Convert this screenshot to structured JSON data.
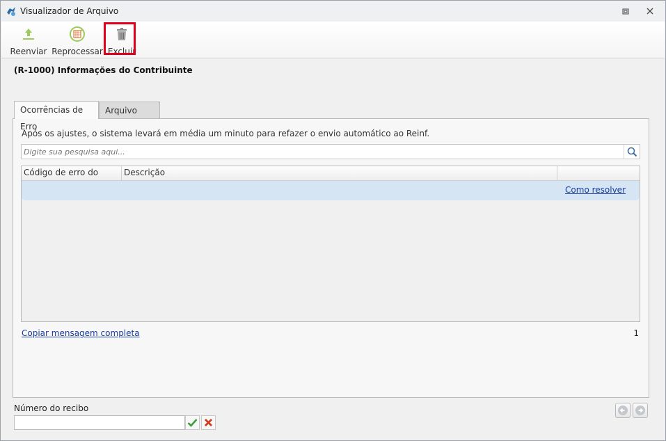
{
  "window": {
    "title": "Visualizador de Arquivo"
  },
  "toolbar": {
    "resend_label": "Reenviar",
    "reprocess_label": "Reprocessar",
    "delete_label": "Excluir"
  },
  "heading": "(R-1000) Informações do Contribuinte",
  "tabs": [
    {
      "label": "Ocorrências de Erro",
      "active": true
    },
    {
      "label": "Arquivo XML",
      "active": false
    }
  ],
  "panel": {
    "info_text": "Após os ajustes, o sistema levará em média um minuto para refazer o envio automático ao Reinf.",
    "search": {
      "placeholder": "Digite sua pesquisa aqui...",
      "value": ""
    },
    "table": {
      "columns": [
        "Código de erro do Reinf",
        "Descrição",
        ""
      ],
      "rows": [
        {
          "code": "",
          "description": "",
          "action": "Como resolver"
        }
      ]
    },
    "copy_link": "Copiar mensagem completa",
    "record_count": "1"
  },
  "receipt": {
    "label": "Número do recibo",
    "value": ""
  },
  "colors": {
    "highlight_border": "#e0001b",
    "selected_row": "#d5e5f3",
    "link": "#1a3ea0",
    "confirm_green": "#3aa13a",
    "cancel_red": "#cc3b1b"
  },
  "icons": {
    "app": "app-logo-icon",
    "resend": "upload-arrow-icon",
    "reprocess": "recycle-calendar-icon",
    "delete": "trash-icon",
    "search": "search-icon",
    "confirm": "check-icon",
    "cancel": "close-x-icon",
    "prev": "arrow-left-icon",
    "next": "arrow-right-icon"
  }
}
